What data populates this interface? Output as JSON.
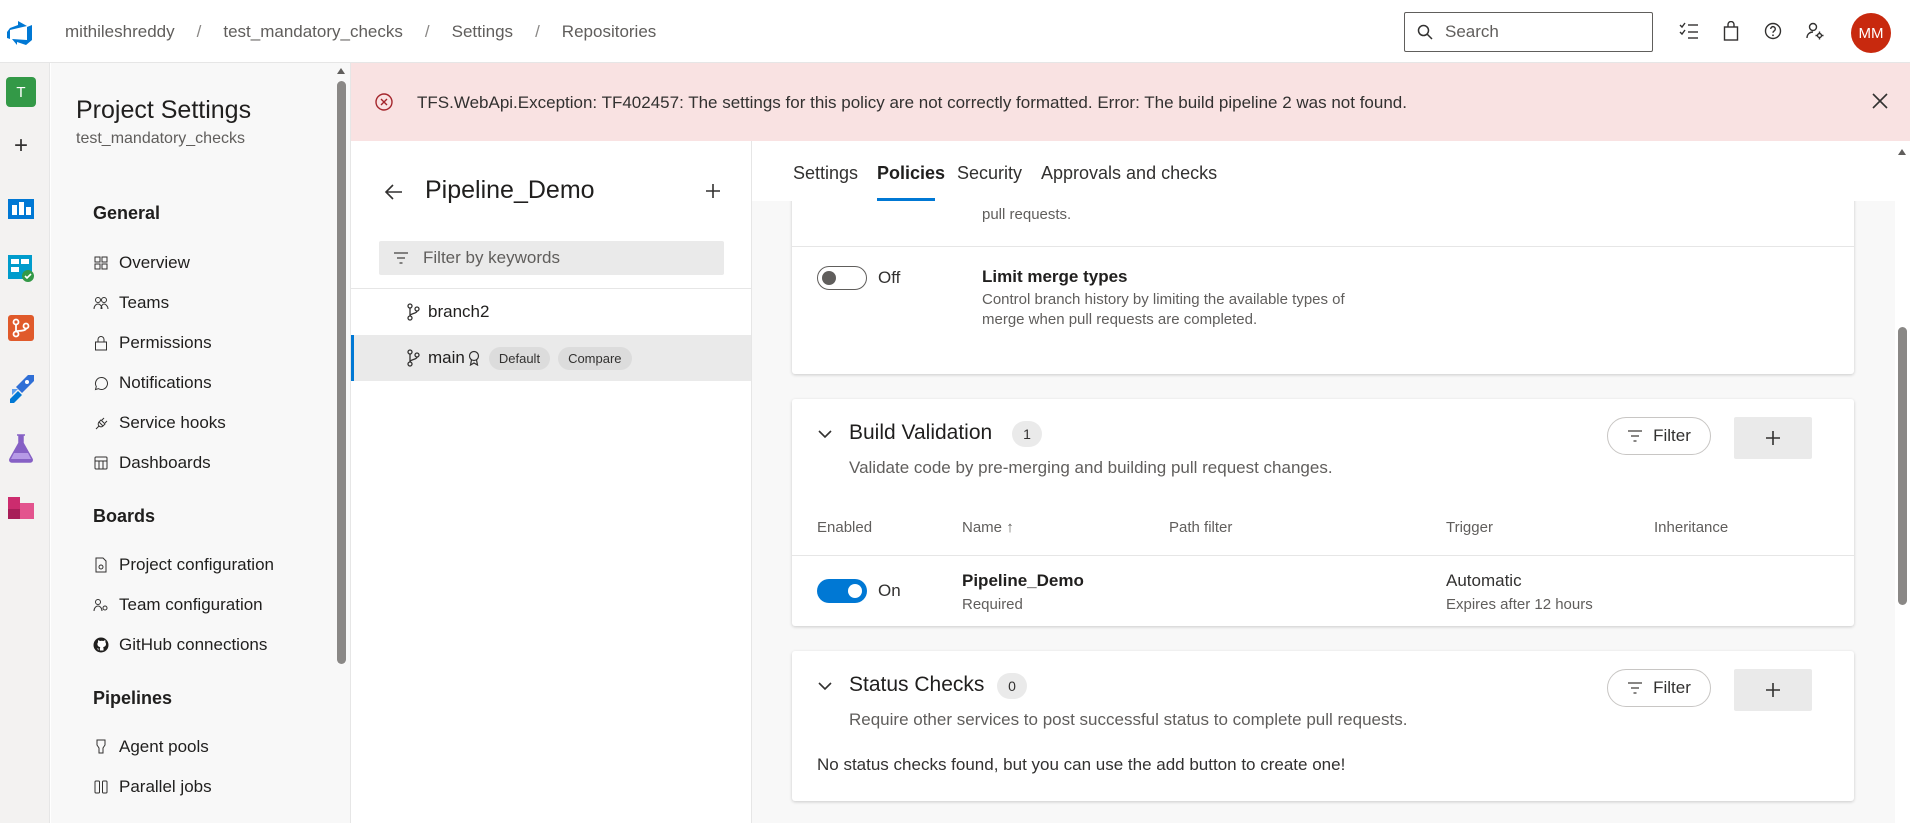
{
  "breadcrumb": {
    "org": "mithileshreddy",
    "project": "test_mandatory_checks",
    "settings": "Settings",
    "page": "Repositories",
    "separator": "/"
  },
  "search": {
    "placeholder": "Search"
  },
  "user": {
    "initials": "MM"
  },
  "rail": {
    "project_letter": "T"
  },
  "nav": {
    "title": "Project Settings",
    "subtitle": "test_mandatory_checks",
    "general": {
      "heading": "General",
      "items": [
        "Overview",
        "Teams",
        "Permissions",
        "Notifications",
        "Service hooks",
        "Dashboards"
      ]
    },
    "boards": {
      "heading": "Boards",
      "items": [
        "Project configuration",
        "Team configuration",
        "GitHub connections"
      ]
    },
    "pipelines": {
      "heading": "Pipelines",
      "items": [
        "Agent pools",
        "Parallel jobs"
      ]
    }
  },
  "banner": {
    "message": "TFS.WebApi.Exception: TF402457: The settings for this policy are not correctly formatted. Error: The build pipeline 2 was not found."
  },
  "repo": {
    "name": "Pipeline_Demo",
    "filter_placeholder": "Filter by keywords",
    "branches": [
      {
        "name": "branch2"
      },
      {
        "name": "main",
        "badges": [
          "Default",
          "Compare"
        ]
      }
    ]
  },
  "tabs": [
    "Settings",
    "Policies",
    "Security",
    "Approvals and checks"
  ],
  "policies": {
    "prev_desc_tail": "pull requests.",
    "limit_merge": {
      "state": "Off",
      "title": "Limit merge types",
      "desc_line1": "Control branch history by limiting the available types of",
      "desc_line2": "merge when pull requests are completed."
    },
    "build_validation": {
      "title": "Build Validation",
      "count": "1",
      "desc": "Validate code by pre-merging and building pull request changes.",
      "filter_label": "Filter",
      "columns": [
        "Enabled",
        "Name",
        "Path filter",
        "Trigger",
        "Inheritance"
      ],
      "rows": [
        {
          "state": "On",
          "name": "Pipeline_Demo",
          "sub": "Required",
          "trigger": "Automatic",
          "trigger_sub": "Expires after 12 hours"
        }
      ]
    },
    "status_checks": {
      "title": "Status Checks",
      "count": "0",
      "desc": "Require other services to post successful status to complete pull requests.",
      "filter_label": "Filter",
      "empty": "No status checks found, but you can use the add button to create one!"
    }
  },
  "colors": {
    "accent": "#0078d4",
    "error_bg": "#f9e2e2",
    "error_icon": "#a4262c",
    "avatar": "#c8290e"
  }
}
